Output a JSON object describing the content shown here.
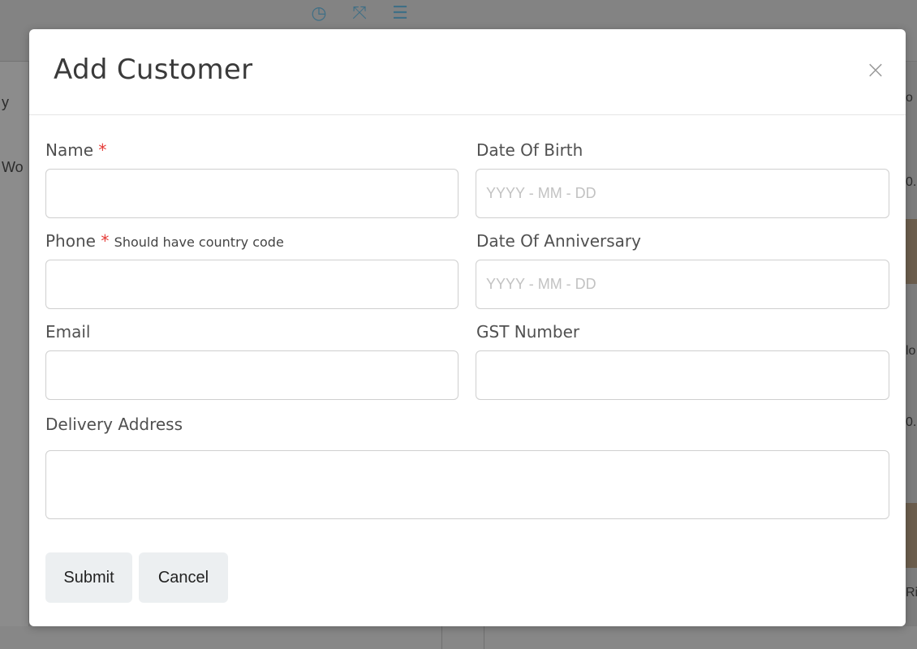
{
  "background": {
    "left_cells": [
      "y",
      "Wo"
    ],
    "right_cells": [
      "o",
      "0.",
      "lo",
      "0.",
      "Ri"
    ]
  },
  "modal": {
    "title": "Add Customer",
    "close_icon": "close-icon",
    "fields": {
      "name": {
        "label": "Name",
        "required_mark": "*",
        "value": "",
        "placeholder": ""
      },
      "dob": {
        "label": "Date Of Birth",
        "value": "",
        "placeholder": "YYYY - MM - DD"
      },
      "phone": {
        "label": "Phone",
        "required_mark": "*",
        "hint": "Should have country code",
        "value": "",
        "placeholder": ""
      },
      "anniversary": {
        "label": "Date Of Anniversary",
        "value": "",
        "placeholder": "YYYY - MM - DD"
      },
      "email": {
        "label": "Email",
        "value": "",
        "placeholder": ""
      },
      "gst": {
        "label": "GST Number",
        "value": "",
        "placeholder": ""
      },
      "address": {
        "label": "Delivery Address",
        "value": "",
        "placeholder": ""
      }
    },
    "buttons": {
      "submit": "Submit",
      "cancel": "Cancel"
    }
  },
  "colors": {
    "required": "#e53935",
    "overlay": "#808080",
    "button_bg": "#eceff1"
  }
}
